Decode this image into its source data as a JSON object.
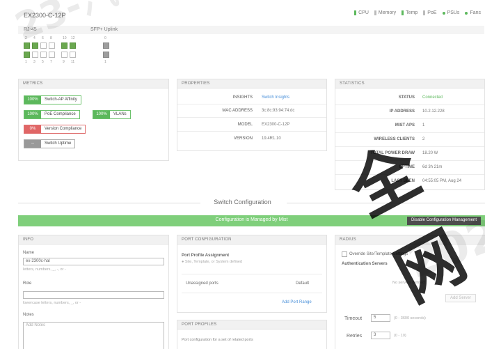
{
  "device": {
    "name": "EX2300-C-12P"
  },
  "legend": [
    {
      "label": "CPU",
      "color": "#5cb85c",
      "shape": "bar"
    },
    {
      "label": "Memory",
      "color": "#bbbbbb",
      "shape": "bar"
    },
    {
      "label": "Temp",
      "color": "#5cb85c",
      "shape": "bar"
    },
    {
      "label": "PoE",
      "color": "#bbbbbb",
      "shape": "bar"
    },
    {
      "label": "PSUs",
      "color": "#5cb85c",
      "shape": "dot"
    },
    {
      "label": "Fans",
      "color": "#5cb85c",
      "shape": "dot"
    }
  ],
  "port_tabs": {
    "rj45": "RJ-45",
    "sfp": "SFP+ Uplink"
  },
  "ports": {
    "top_numbers": [
      "2",
      "4",
      "6",
      "8",
      "10",
      "12"
    ],
    "bottom_numbers": [
      "1",
      "3",
      "5",
      "7",
      "9",
      "11"
    ],
    "uplink_top": "0",
    "uplink_bottom": "1"
  },
  "metrics": {
    "title": "METRICS",
    "items": [
      {
        "pct": "100%",
        "label": "Switch-AP Affinity",
        "status": "green"
      },
      {
        "pct": "100%",
        "label": "PoE Compliance",
        "status": "green"
      },
      {
        "pct": "100%",
        "label": "VLANs",
        "status": "green"
      },
      {
        "pct": "0%",
        "label": "Version Compliance",
        "status": "red"
      },
      {
        "pct": "--",
        "label": "Switch Uptime",
        "status": "grey"
      }
    ]
  },
  "properties": {
    "title": "PROPERTIES",
    "rows": [
      {
        "k": "INSIGHTS",
        "v": "Switch Insights"
      },
      {
        "k": "MAC ADDRESS",
        "v": "3c:8c:93:94:74:dc"
      },
      {
        "k": "MODEL",
        "v": "EX2300-C-12P"
      },
      {
        "k": "VERSION",
        "v": "19.4R1.10"
      }
    ]
  },
  "statistics": {
    "title": "STATISTICS",
    "rows": [
      {
        "k": "STATUS",
        "v": "Connected"
      },
      {
        "k": "IP ADDRESS",
        "v": "10.2.12.228"
      },
      {
        "k": "MIST APS",
        "v": "1"
      },
      {
        "k": "WIRELESS CLIENTS",
        "v": "2"
      },
      {
        "k": "TOTAL POWER DRAW",
        "v": "18.20 W"
      },
      {
        "k": "UPTIME",
        "v": "6d 3h 21m"
      },
      {
        "k": "LAST SEEN",
        "v": "04:55:05 PM, Aug 24"
      }
    ]
  },
  "config": {
    "section_title": "Switch Configuration",
    "managed_text": "Configuration is Managed by Mist",
    "disable_button": "Disable Configuration Management"
  },
  "info": {
    "title": "INFO",
    "name_label": "Name",
    "name_value": "ex-2300c-hal",
    "name_hint": "letters, numbers, _, -, or -",
    "role_label": "Role",
    "role_value": "",
    "role_hint": "lowercase letters, numbers, _, or -",
    "notes_label": "Notes",
    "notes_placeholder": "Add Notes"
  },
  "port_config": {
    "title": "PORT CONFIGURATION",
    "assignment_label": "Port Profile Assignment",
    "assignment_hint": "Site, Template, or System defined",
    "unassigned_label": "Unassigned ports",
    "unassigned_value": "Default",
    "add_range": "Add Port Range"
  },
  "port_profiles": {
    "title": "PORT PROFILES",
    "desc": "Port configuration for a set of related ports"
  },
  "radius": {
    "title": "RADIUS",
    "override_label": "Override Site/Template Settings",
    "auth_servers_label": "Authentication Servers",
    "no_servers": "No servers defined",
    "add_server": "Add Server",
    "timeout_label": "Timeout",
    "timeout_value": "5",
    "timeout_hint": "(0 - 3600 seconds)",
    "retries_label": "Retries",
    "retries_value": "3",
    "retries_hint": "(0 - 10)"
  },
  "watermark": {
    "left": "23-汽千",
    "right": "全网",
    "bottom": "202"
  }
}
